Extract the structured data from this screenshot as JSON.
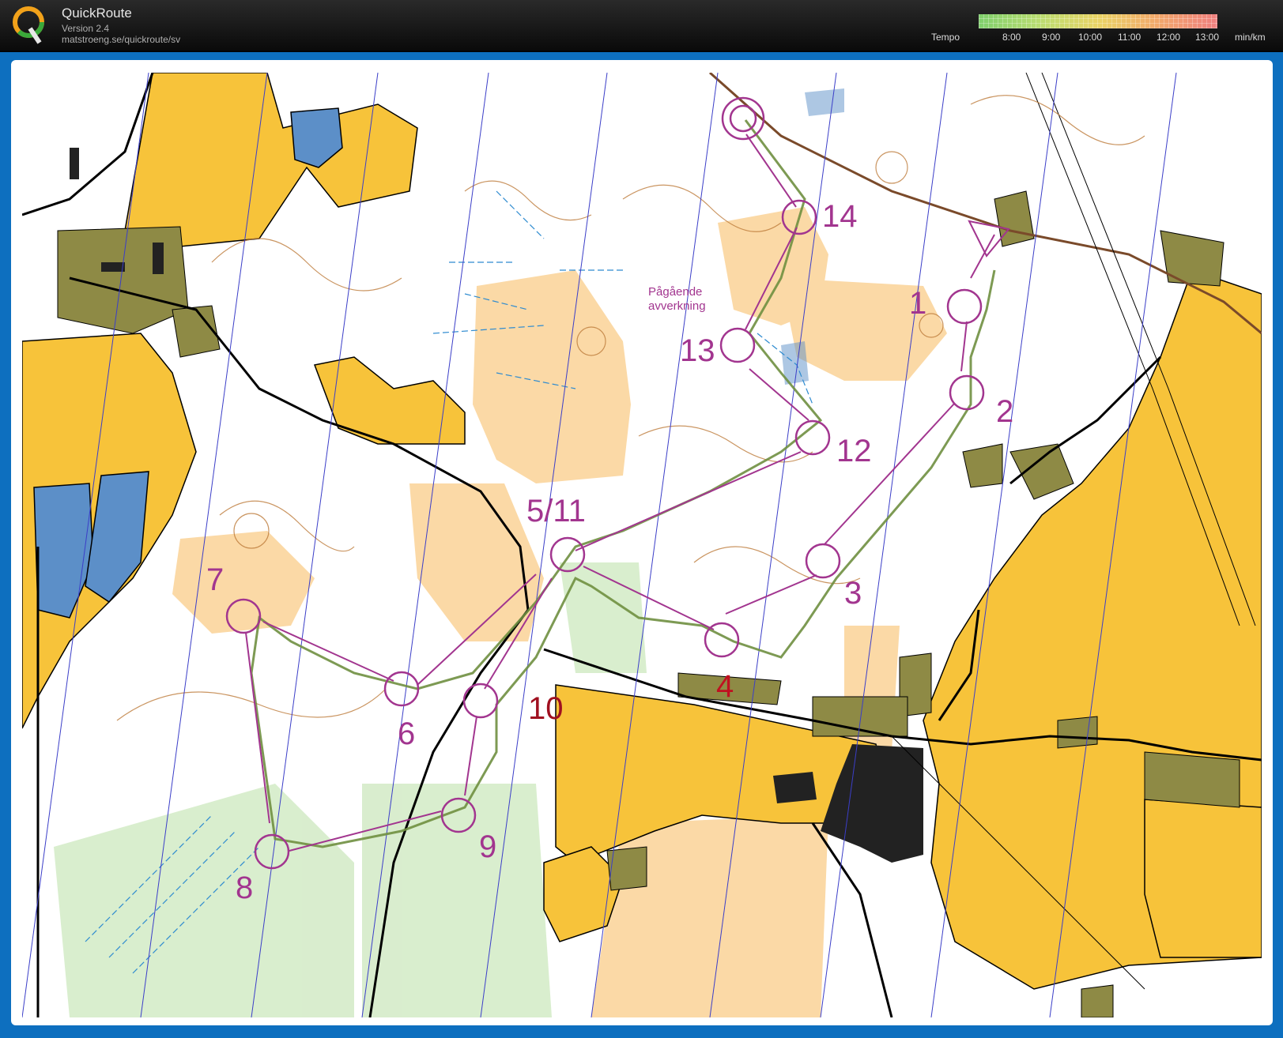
{
  "header": {
    "app_name": "QuickRoute",
    "version": "Version 2.4",
    "url": "matstroeng.se/quickroute/sv",
    "logo_letter": "Q"
  },
  "tempo": {
    "label": "Tempo",
    "ticks": [
      "8:00",
      "9:00",
      "10:00",
      "11:00",
      "12:00",
      "13:00"
    ],
    "unit": "min/km"
  },
  "map": {
    "colors": {
      "open": "#f7c33a",
      "rough": "#fbd9a6",
      "water": "#5c8fc8",
      "building": "#222222",
      "settlement": "#8e8a45",
      "course": "#a2358f",
      "route": "#6f8f40",
      "meridian": "#3b3ec8",
      "contour": "#bd7b3a"
    },
    "annotation": [
      "Pågående",
      "avverkning"
    ],
    "controls": [
      {
        "label": "1"
      },
      {
        "label": "2"
      },
      {
        "label": "3"
      },
      {
        "label": "4"
      },
      {
        "label": "5/11"
      },
      {
        "label": "6"
      },
      {
        "label": "7"
      },
      {
        "label": "8"
      },
      {
        "label": "9"
      },
      {
        "label": "10"
      },
      {
        "label": "12"
      },
      {
        "label": "13"
      },
      {
        "label": "14"
      }
    ]
  }
}
